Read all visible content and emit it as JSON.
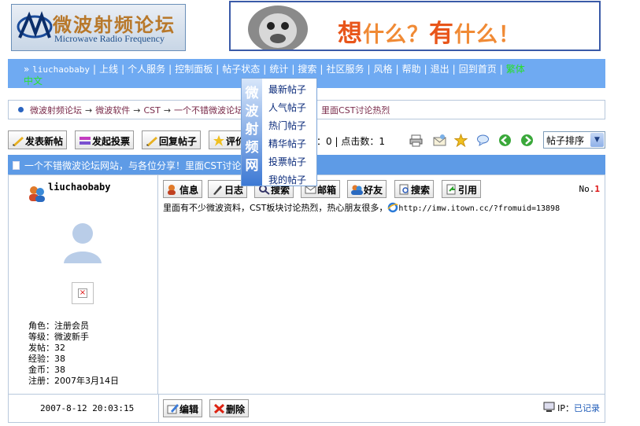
{
  "logo": {
    "cn": "微波射频论坛",
    "en": "Microwave Radio Frequency"
  },
  "banner": {
    "part1": "想",
    "part2": "什么？",
    "part3": "有",
    "part4": "什么！"
  },
  "nav": {
    "user": "liuchaobaby",
    "items": [
      "上线",
      "个人服务",
      "控制面板",
      "帖子状态",
      "统计",
      "搜索",
      "社区服务",
      "风格",
      "帮助",
      "退出",
      "回到首页"
    ],
    "theme": "繁体",
    "line2": "中文"
  },
  "breadcrumb": [
    "微波射频论坛",
    "微波软件",
    "CST",
    "一个不错微波论坛网站，与各位分享！里面CST讨论热烈"
  ],
  "toolbar": {
    "buttons": [
      "发表新帖",
      "发起投票",
      "回复帖子",
      "评价"
    ],
    "stats_label1": "数：",
    "replies": "0",
    "stats_label2": "点击数：",
    "clicks": "1",
    "sort": "帖子排序"
  },
  "thread_title": "一个不错微波论坛网站，与各位分享！里面CST讨论热烈",
  "post": {
    "author": "liuchaobaby",
    "role": "角色：注册会员",
    "level": "等级：微波新手",
    "posts": "发帖：32",
    "exp": "经验：38",
    "gold": "金币：38",
    "reg": "注册：2007年3月14日",
    "buttons": [
      "信息",
      "日志",
      "搜索",
      "邮箱",
      "好友",
      "搜索",
      "引用"
    ],
    "no_label": "No.",
    "no_value": "1",
    "content_text": "里面有不少微波资料，CST板块讨论热烈，热心朋友很多，",
    "content_url": "http://imw.itown.cc/?fromuid=13898",
    "date": "2007-8-12 20:03:15",
    "edit": "编辑",
    "delete": "删除",
    "ip_label": "IP：",
    "ip_value": "已记录"
  },
  "menu": {
    "side": "微波射频网",
    "items": [
      "最新帖子",
      "人气帖子",
      "热门帖子",
      "精华帖子",
      "投票帖子",
      "我的帖子"
    ]
  },
  "colors": {
    "nav_bg": "#6faaf2",
    "thread_bg": "#5e9be6",
    "crumb_text": "#7a2b4a",
    "theme_green": "#27e027"
  }
}
